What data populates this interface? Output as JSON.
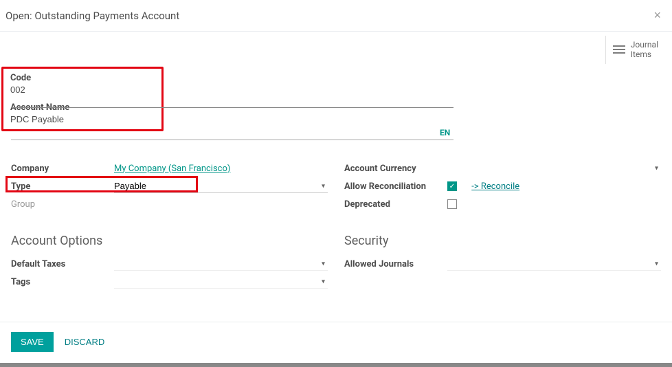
{
  "header": {
    "title": "Open: Outstanding Payments Account"
  },
  "journal": {
    "line1": "Journal",
    "line2": "Items"
  },
  "main": {
    "code_label": "Code",
    "code_value": "002",
    "name_label": "Account Name",
    "name_value": "PDC Payable",
    "lang_badge": "EN",
    "left": {
      "company_label": "Company",
      "company_value": "My Company (San Francisco)",
      "type_label": "Type",
      "type_value": "Payable",
      "group_label": "Group"
    },
    "right": {
      "currency_label": "Account Currency",
      "reconcile_label": "Allow Reconciliation",
      "reconcile_checked": true,
      "reconcile_link": "-> Reconcile",
      "deprecated_label": "Deprecated",
      "deprecated_checked": false
    }
  },
  "sections": {
    "options_title": "Account Options",
    "default_taxes_label": "Default Taxes",
    "tags_label": "Tags",
    "security_title": "Security",
    "allowed_journals_label": "Allowed Journals"
  },
  "footer": {
    "save": "SAVE",
    "discard": "DISCARD"
  }
}
